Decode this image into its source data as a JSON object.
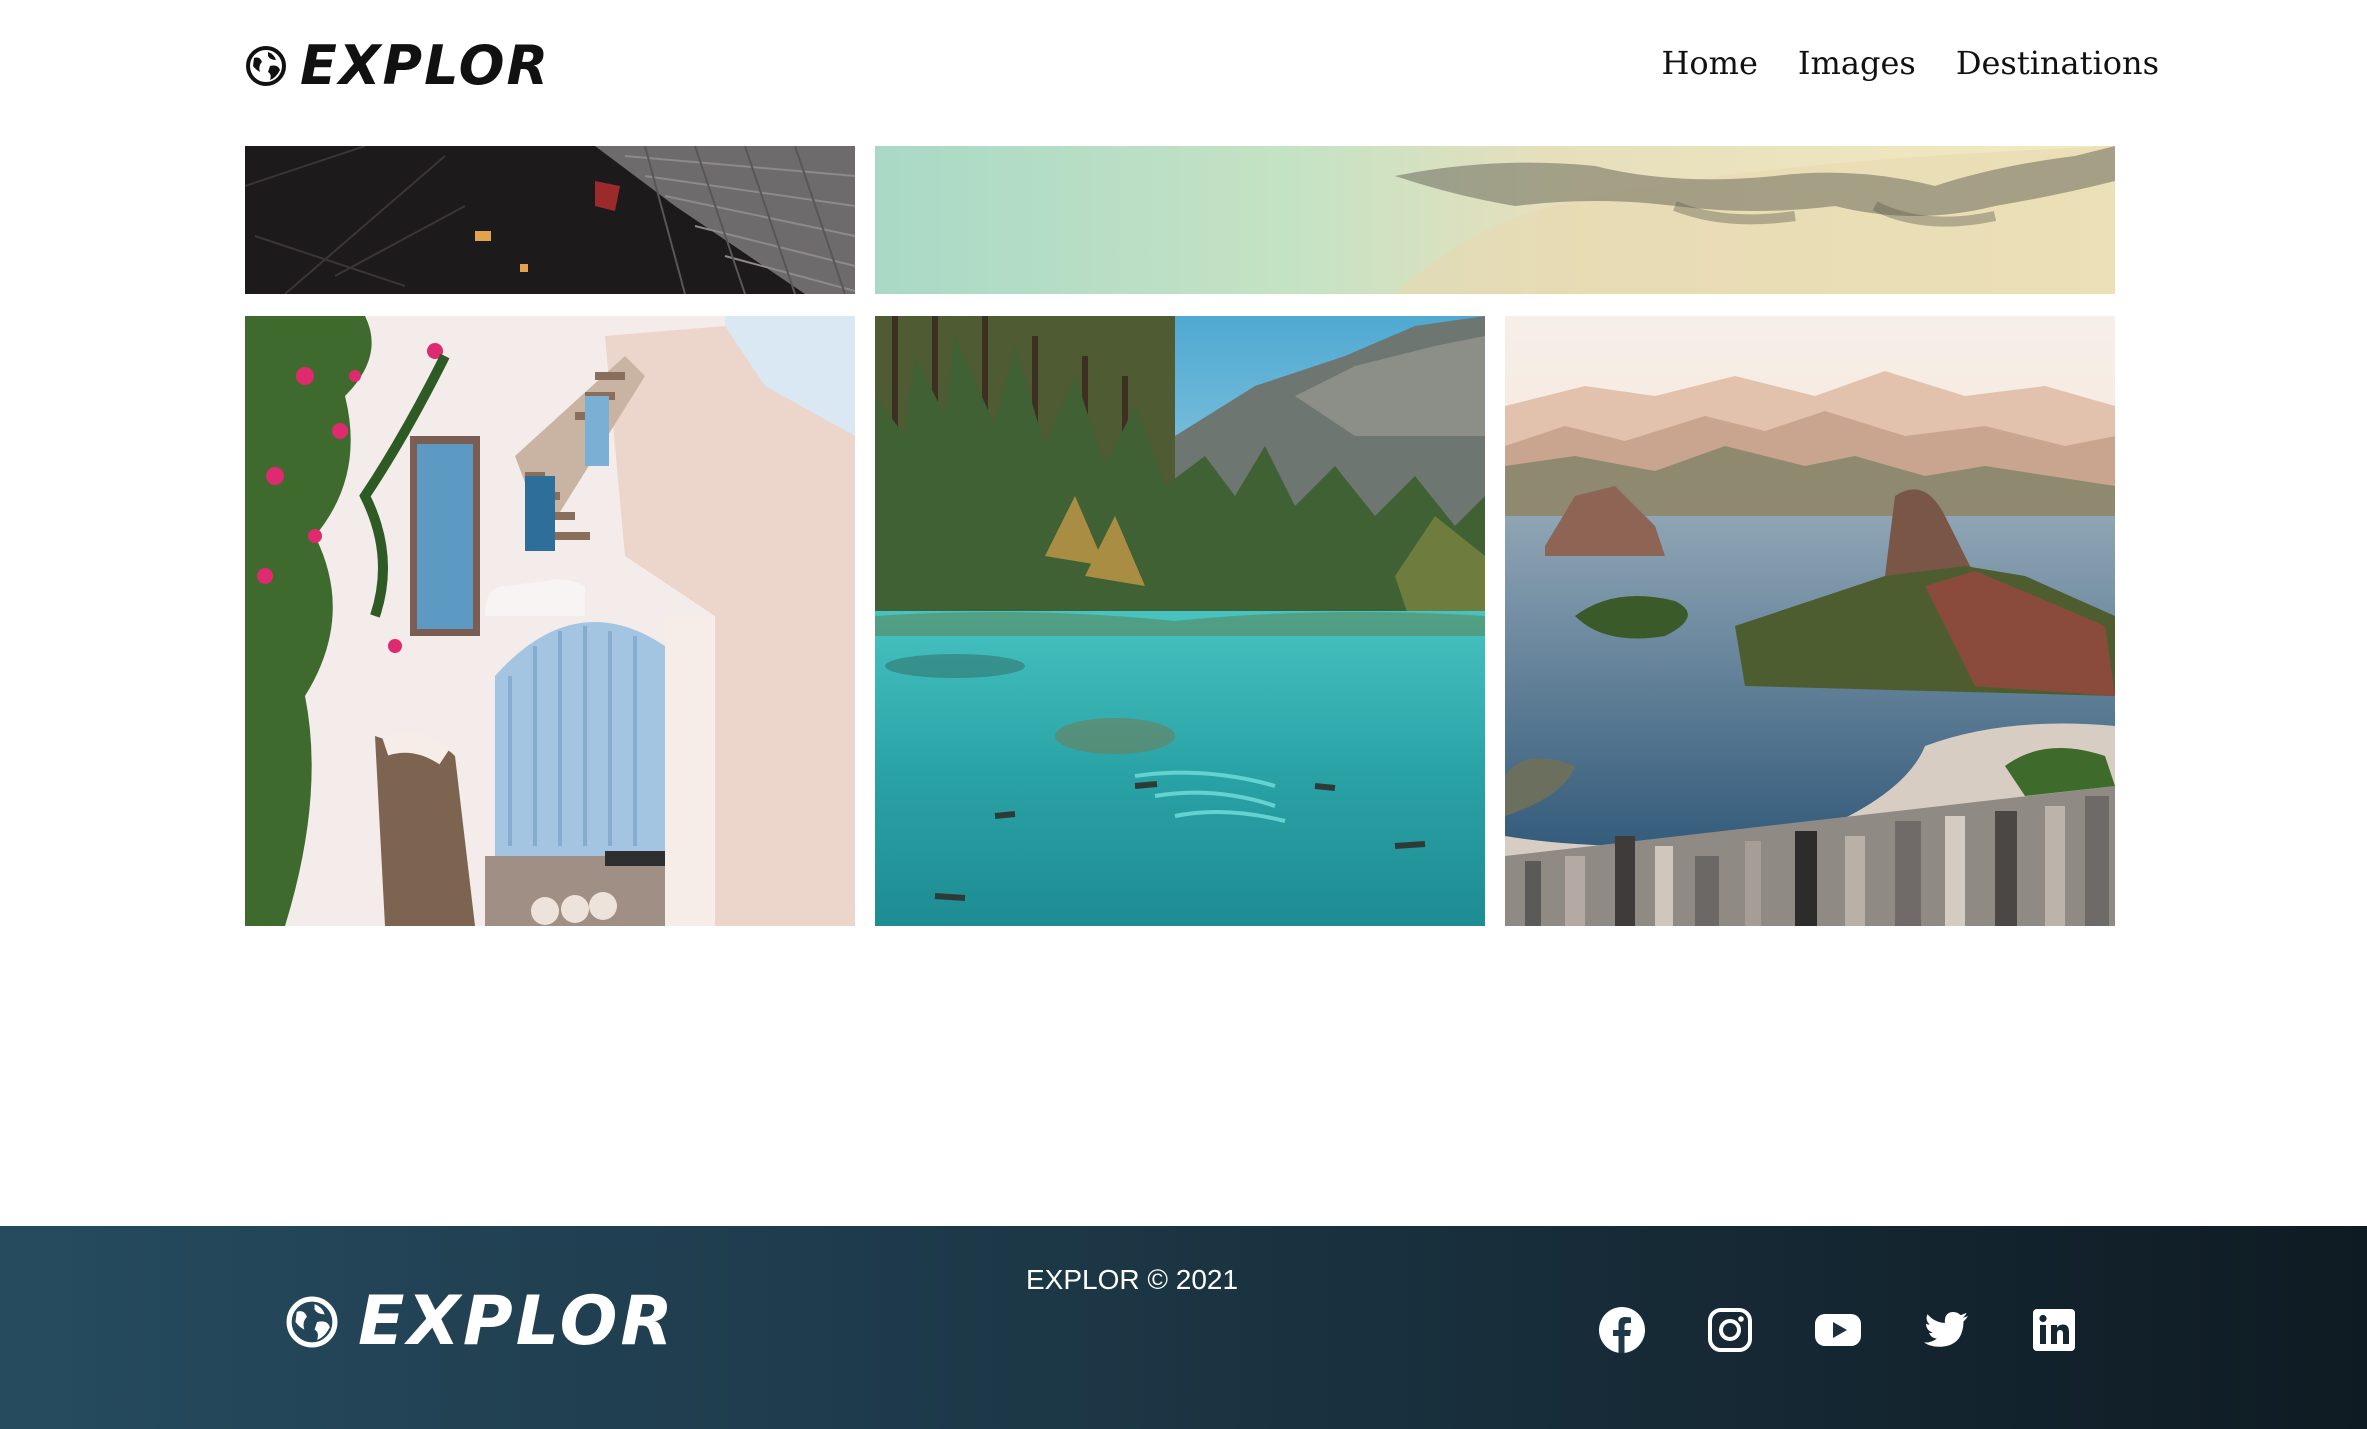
{
  "header": {
    "brand": "EXPLOR",
    "nav": [
      {
        "label": "Home"
      },
      {
        "label": "Images"
      },
      {
        "label": "Destinations"
      }
    ]
  },
  "gallery": {
    "tiles": [
      {
        "name": "village-rooftop-photo"
      },
      {
        "name": "beach-shoreline-photo"
      },
      {
        "name": "santorini-door-photo"
      },
      {
        "name": "turquoise-lake-photo"
      },
      {
        "name": "rio-de-janeiro-bay-photo"
      }
    ]
  },
  "footer": {
    "brand": "EXPLOR",
    "copyright": "EXPLOR © 2021",
    "socials": [
      {
        "icon": "facebook-icon"
      },
      {
        "icon": "instagram-icon"
      },
      {
        "icon": "youtube-icon"
      },
      {
        "icon": "twitter-icon"
      },
      {
        "icon": "linkedin-icon"
      }
    ]
  },
  "colors": {
    "footer_gradient_start": "#264b5f",
    "footer_gradient_end": "#0f1b23"
  }
}
